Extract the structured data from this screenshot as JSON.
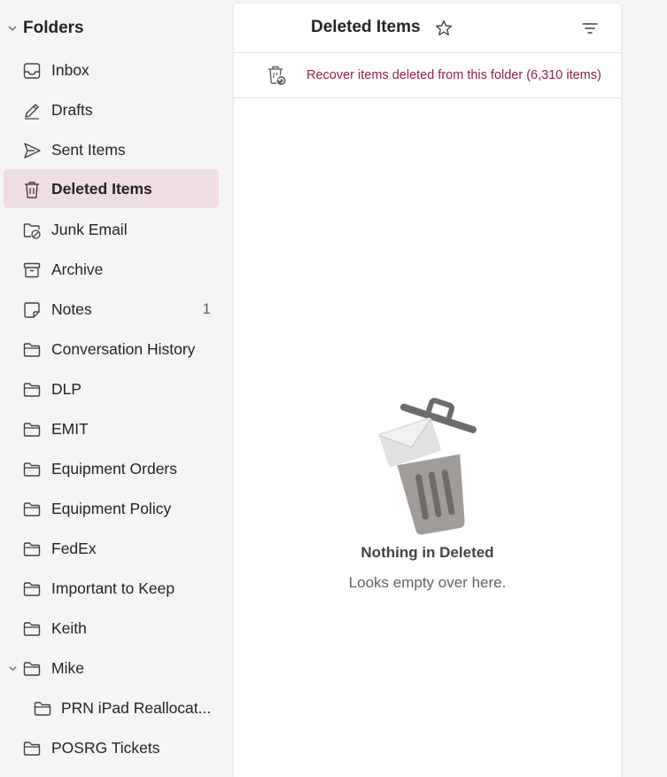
{
  "sidebar": {
    "header_label": "Folders",
    "items": [
      {
        "label": "Inbox",
        "icon": "inbox-icon"
      },
      {
        "label": "Drafts",
        "icon": "pencil-icon"
      },
      {
        "label": "Sent Items",
        "icon": "send-icon"
      },
      {
        "label": "Deleted Items",
        "icon": "trash-icon",
        "selected": true
      },
      {
        "label": "Junk Email",
        "icon": "junk-folder-icon"
      },
      {
        "label": "Archive",
        "icon": "archive-icon"
      },
      {
        "label": "Notes",
        "icon": "note-icon",
        "count": "1"
      },
      {
        "label": "Conversation History",
        "icon": "folder-icon"
      },
      {
        "label": "DLP",
        "icon": "folder-icon"
      },
      {
        "label": "EMIT",
        "icon": "folder-icon"
      },
      {
        "label": "Equipment Orders",
        "icon": "folder-icon"
      },
      {
        "label": "Equipment Policy",
        "icon": "folder-icon"
      },
      {
        "label": "FedEx",
        "icon": "folder-icon"
      },
      {
        "label": "Important to Keep",
        "icon": "folder-icon"
      },
      {
        "label": "Keith",
        "icon": "folder-icon"
      },
      {
        "label": "Mike",
        "icon": "folder-icon",
        "expanded": true
      },
      {
        "label": "PRN iPad Reallocat...",
        "icon": "folder-icon",
        "nested": true
      },
      {
        "label": "POSRG Tickets",
        "icon": "folder-icon"
      }
    ]
  },
  "main": {
    "title": "Deleted Items",
    "recover_text": "Recover items deleted from this folder (6,310 items)",
    "empty_title": "Nothing in Deleted",
    "empty_subtitle": "Looks empty over here."
  },
  "colors": {
    "selected_bg": "#f0dde4",
    "recover_link": "#8c2249",
    "sidebar_bg": "#f5f5f5"
  }
}
